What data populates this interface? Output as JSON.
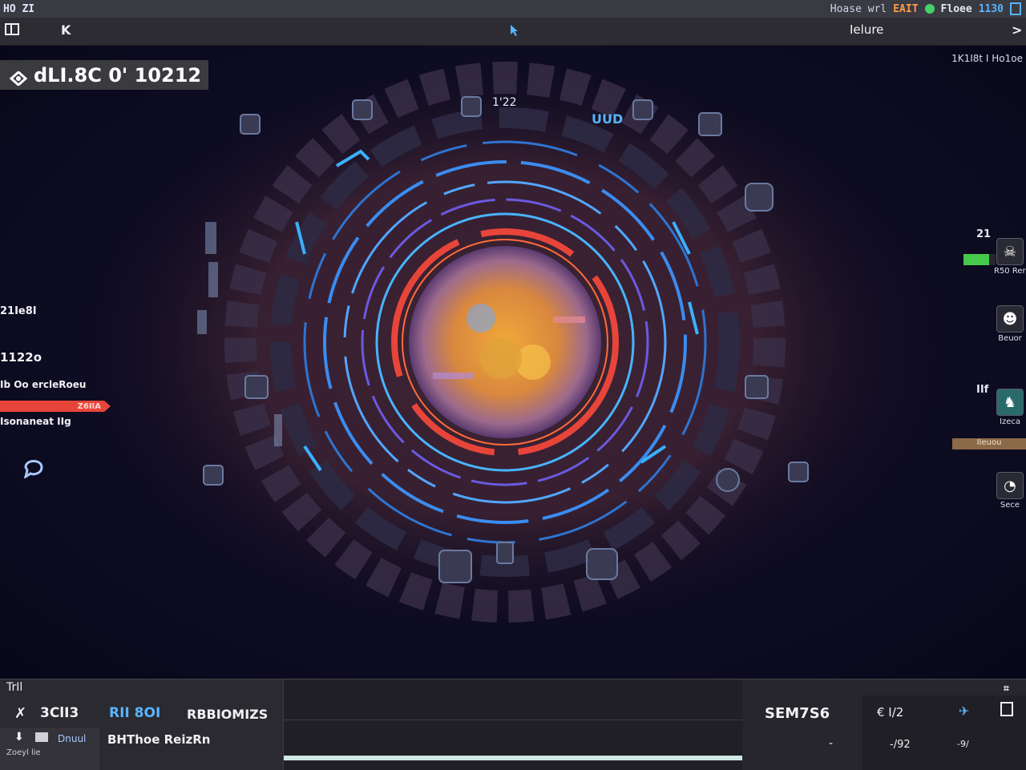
{
  "topbar": {
    "left": "HO ZI",
    "right_items": [
      "Hoase wrl",
      "EAIT",
      "Floee",
      "1130"
    ],
    "accent_colors": {
      "orange": "#ff9b4a",
      "green": "#46d16a",
      "blue": "#58b4ff"
    }
  },
  "toolbar": {
    "menu_icon": "panel-icon",
    "back_label": "K",
    "center_icon": "cursor-icon",
    "tab_label": "Ielure",
    "forward_label": ">"
  },
  "hud": {
    "title": "dLI.8C 0' 10212",
    "top_right_label": "1K1I8t  I Ho1oe",
    "ring_label_top": "1'22",
    "ring_label_right": "UUD",
    "left_stats": [
      "21Ie8I",
      "1122o",
      "Ib Oo ercleRoeu",
      "Isonaneat IIg"
    ],
    "hp": {
      "label": "Z6IIA",
      "fraction": 0.94,
      "color": "#e8453a"
    },
    "right_panel": {
      "count_top": "21",
      "count_mid": "IIf",
      "green_bar_fraction": 0.8,
      "items": [
        {
          "icon": "skull-icon",
          "label": "R50 Rerec"
        },
        {
          "icon": "ghost-icon",
          "label": "Beuor"
        },
        {
          "icon": "figure-icon",
          "label": "Izeca"
        },
        {
          "icon": "gauge-icon",
          "label": "Sece"
        }
      ],
      "tag": "IIeuou"
    }
  },
  "bottom": {
    "tab_label": "TrIl",
    "row1": {
      "name": "3ClI3",
      "link": "RII 8OI",
      "label": "RBBIOMIZS"
    },
    "row2": {
      "left_small": "Dnuul",
      "sub": "Zoeyl lie",
      "label": "BHThoe ReizRn"
    },
    "progress_fraction": 1.0,
    "right": {
      "title": "SEM7S6",
      "val1": "€ I/2",
      "val2": "-",
      "val3": "-/92",
      "val4": "-9/"
    }
  }
}
